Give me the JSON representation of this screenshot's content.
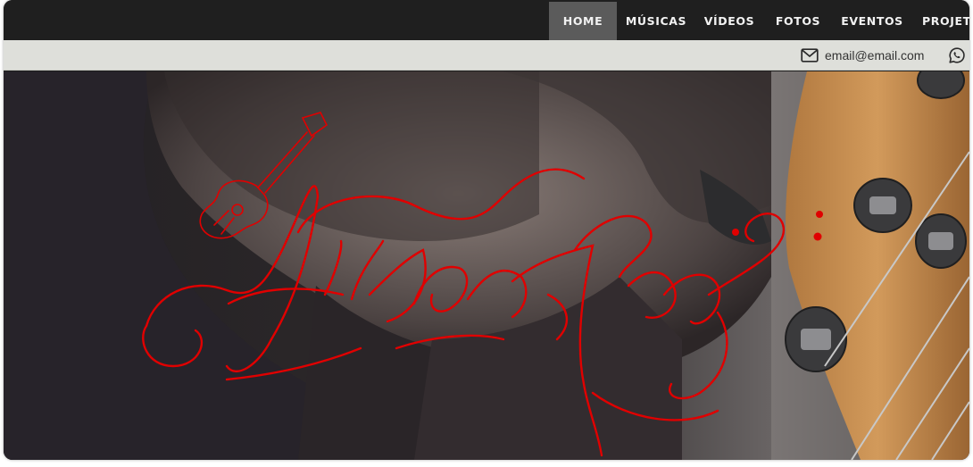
{
  "nav": {
    "items": [
      {
        "label": "HOME",
        "active": true
      },
      {
        "label": "MÚSICAS",
        "active": false
      },
      {
        "label": "VÍDEOS",
        "active": false
      },
      {
        "label": "FOTOS",
        "active": false
      },
      {
        "label": "EVENTOS",
        "active": false
      },
      {
        "label": "PROJETO",
        "active": false
      }
    ]
  },
  "contact": {
    "email": "email@email.com",
    "email_icon": "envelope-icon",
    "whatsapp_icon": "whatsapp-icon"
  },
  "hero": {
    "logo_text": "Alisson Haas",
    "logo_icon": "guitar-icon",
    "photo": "musician-with-bass-guitar-photo",
    "accent_color": "#e00000"
  },
  "colors": {
    "nav_bg": "#1f1f1f",
    "nav_active_bg": "#5b5b5b",
    "contact_bar_bg": "#dedfda"
  }
}
